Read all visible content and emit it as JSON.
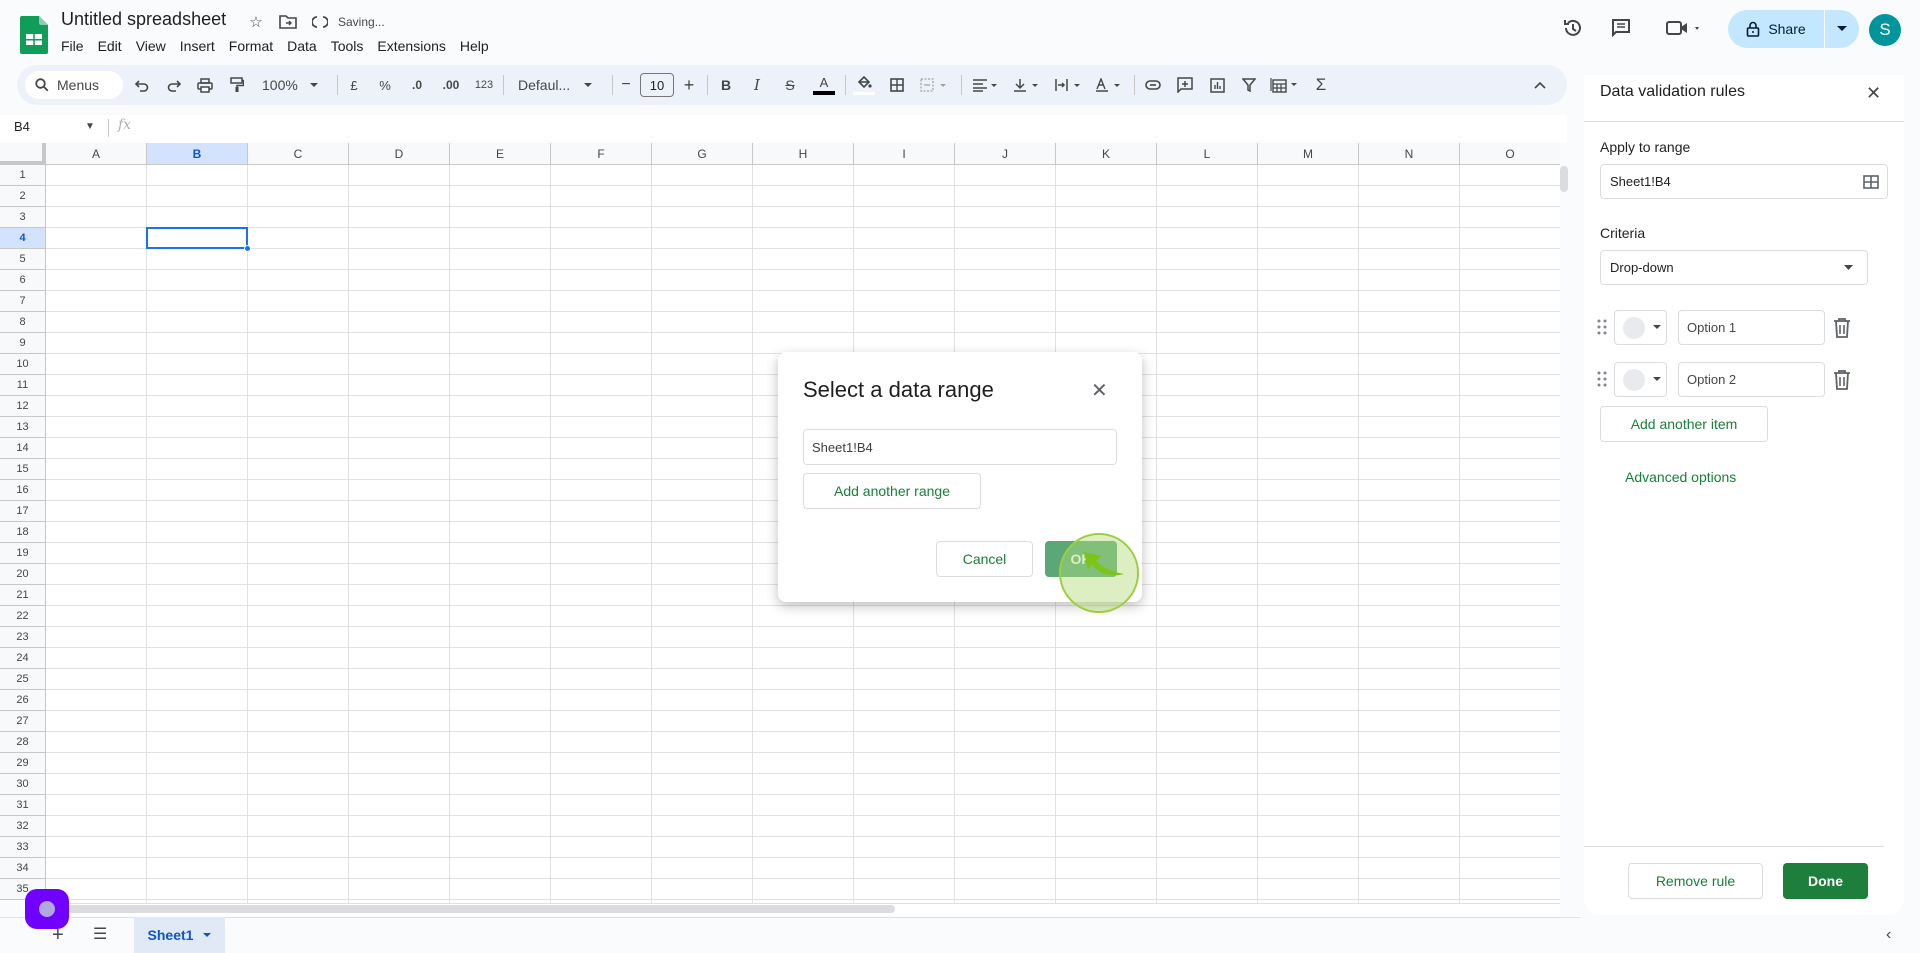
{
  "app": {
    "title": "Untitled spreadsheet",
    "status": "Saving...",
    "menu": [
      "File",
      "Edit",
      "View",
      "Insert",
      "Format",
      "Data",
      "Tools",
      "Extensions",
      "Help"
    ],
    "share_label": "Share",
    "avatar_initial": "S",
    "brand_color": "#0f9d58"
  },
  "toolbar": {
    "search_label": "Menus",
    "zoom": "100%",
    "currency": "£",
    "percent": "%",
    "decrease_decimals": ".0",
    "increase_decimals": ".00",
    "number_format": "123",
    "font": "Defaul...",
    "font_size": "10",
    "minus": "−",
    "plus": "+",
    "bold": "B",
    "italic": "I",
    "strike": "S",
    "text_color": "A",
    "sum": "Σ"
  },
  "formula_bar": {
    "name_box": "B4",
    "fx": "fx",
    "formula": ""
  },
  "grid": {
    "columns": [
      "A",
      "B",
      "C",
      "D",
      "E",
      "F",
      "G",
      "H",
      "I",
      "J",
      "K",
      "L",
      "M",
      "N",
      "O"
    ],
    "rows": [
      "1",
      "2",
      "3",
      "4",
      "5",
      "6",
      "7",
      "8",
      "9",
      "10",
      "11",
      "12",
      "13",
      "14",
      "15",
      "16",
      "17",
      "18",
      "19",
      "20",
      "21",
      "22",
      "23",
      "24",
      "25",
      "26",
      "27",
      "28",
      "29",
      "30",
      "31",
      "32",
      "33",
      "34",
      "35"
    ],
    "selected_column": "B",
    "selected_row": "4"
  },
  "sheets": {
    "tabs": [
      "Sheet1"
    ],
    "active": "Sheet1"
  },
  "side_panel": {
    "title": "Data validation rules",
    "apply_label": "Apply to range",
    "apply_value": "Sheet1!B4",
    "criteria_label": "Criteria",
    "criteria_value": "Drop-down",
    "options": [
      {
        "value": "Option 1"
      },
      {
        "value": "Option 2"
      }
    ],
    "add_item_label": "Add another item",
    "advanced_label": "Advanced options",
    "remove_label": "Remove rule",
    "done_label": "Done"
  },
  "dialog": {
    "title": "Select a data range",
    "range_value": "Sheet1!B4",
    "add_range_label": "Add another range",
    "cancel_label": "Cancel",
    "ok_label": "OK"
  }
}
